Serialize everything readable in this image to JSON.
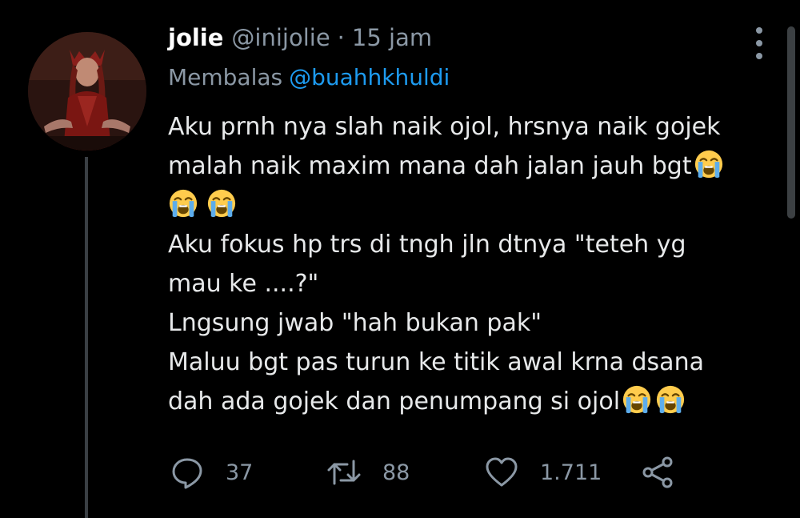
{
  "tweet": {
    "display_name": "jolie",
    "handle": "@inijolie",
    "separator": "·",
    "time": "15 jam",
    "replying_prefix": "Membalas",
    "replying_to": "@buahhkhuldi",
    "lines": [
      "Aku prnh nya slah naik ojol, hrsnya naik gojek",
      "malah naik maxim mana dah jalan jauh bgt",
      "",
      "Aku fokus hp trs di tngh jln dtnya \"teteh yg",
      "mau ke ....?\"",
      "Lngsung jwab \"hah bukan pak\"",
      "Maluu bgt pas turun ke titik awal krna dsana",
      "dah ada gojek dan penumpang si ojol"
    ],
    "emoji": "loudly-crying-face"
  },
  "actions": {
    "reply_count": "37",
    "retweet_count": "88",
    "like_count": "1.711"
  },
  "icons": {
    "reply": "reply-icon",
    "retweet": "retweet-icon",
    "like": "heart-icon",
    "share": "share-icon",
    "more": "more-vertical-icon"
  },
  "colors": {
    "background": "#000000",
    "text": "#e7e9ea",
    "muted": "#8b98a5",
    "link": "#1d9bf0"
  }
}
